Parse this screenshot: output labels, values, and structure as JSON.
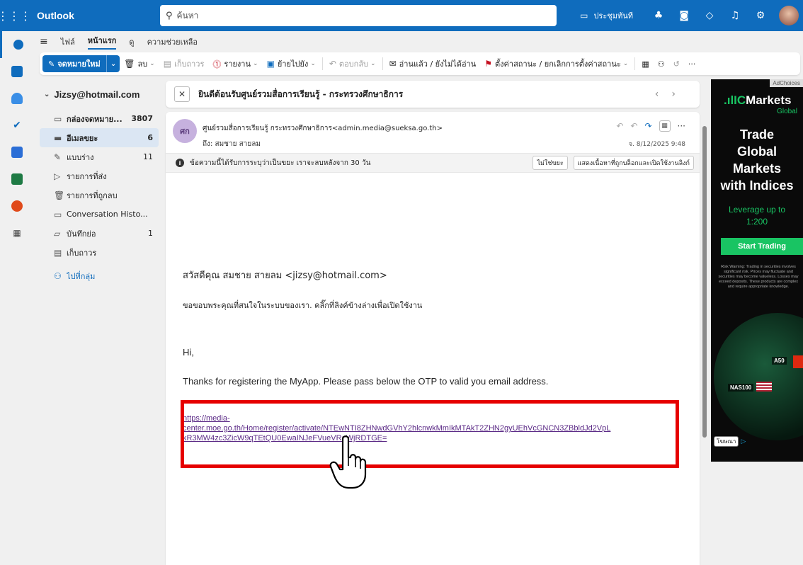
{
  "topbar": {
    "app_name": "Outlook",
    "search_placeholder": "ค้นหา",
    "meet_now": "ประชุมทันที",
    "icons": [
      "waffle-icon",
      "teams-icon",
      "outlook-icon",
      "feedback-icon",
      "bell-icon",
      "gear-icon"
    ]
  },
  "menu": {
    "items": [
      "ไฟล์",
      "หน้าแรก",
      "ดู",
      "ความช่วยเหลือ"
    ],
    "selected": "หน้าแรก"
  },
  "ribbon": {
    "new_mail": "จดหมายใหม่",
    "delete": "ลบ",
    "archive": "เก็บถาวร",
    "report": "รายงาน",
    "move_to": "ย้ายไปยัง",
    "reply": "ตอบกลับ",
    "read_unread": "อ่านแล้ว / ยังไม่ได้อ่าน",
    "flag": "ตั้งค่าสถานะ / ยกเลิกการตั้งค่าสถานะ",
    "more": "···"
  },
  "folders": {
    "account": "Jizsy@hotmail.com",
    "items": [
      {
        "label": "กล่องจดหมาย...",
        "count": "3807",
        "bold": true,
        "icon": "inbox-icon"
      },
      {
        "label": "อีเมลขยะ",
        "count": "6",
        "bold": true,
        "selected": true,
        "icon": "junk-icon"
      },
      {
        "label": "แบบร่าง",
        "count": "11",
        "icon": "draft-icon"
      },
      {
        "label": "รายการที่ส่ง",
        "count": "",
        "icon": "sent-icon"
      },
      {
        "label": "รายการที่ถูกลบ",
        "count": "",
        "icon": "trash-icon"
      },
      {
        "label": "Conversation Histo...",
        "count": "",
        "icon": "folder-icon"
      },
      {
        "label": "บันทึกย่อ",
        "count": "1",
        "icon": "note-icon"
      },
      {
        "label": "เก็บถาวร",
        "count": "",
        "icon": "archive-icon"
      },
      {
        "label": "ไปที่กลุ่ม",
        "count": "",
        "icon": "groups-icon",
        "link": true
      }
    ]
  },
  "message": {
    "subject": "ยินดีต้อนรับศูนย์รวมสื่อการเรียนรู้ - กระทรวงศึกษาธิการ",
    "avatar_initials": "ศก",
    "sender": "ศูนย์รวมสื่อการเรียนรู้ กระทรวงศึกษาธิการ<admin.media@sueksa.go.th>",
    "to": "ถึง: สมชาย สายลม",
    "date": "จ. 8/12/2025 9:48",
    "junk_notice": "ข้อความนี้ได้รับการระบุว่าเป็นขยะ เราจะลบหลังจาก 30 วัน",
    "not_junk": "ไม่ใช่ขยะ",
    "show_blocked": "แสดงเนื้อหาที่ถูกบล็อกและเปิดใช้งานลิงก์",
    "greeting": "สวัสดีคุณ สมชาย สายลม <jizsy@hotmail.com>",
    "thai_line": "ขอขอบพระคุณที่สนใจในระบบของเรา. คลิ๊กที่ลิงค์ข้างล่างเพื่อเปิดใช้งาน",
    "hi": "Hi,",
    "en_line": "Thanks for registering the MyApp. Please pass below the OTP to valid you email address.",
    "link_l1": "https://media-",
    "link_l2": "center.moe.go.th/Home/register/activate/NTEwNTI8ZHNwdGVhY2hlcnwkMmIkMTAkT2ZHN2gyUEhVcGNCN3ZBbldJd2VpL",
    "link_l3": "kR3MW4zc3ZicW9qTEtQU0EwaINJeFVueVRaWjRDTGE="
  },
  "ad": {
    "adchoices": "AdChoices",
    "brand_ic": "IC",
    "brand_rest": "Markets",
    "global": "Global",
    "headline": [
      "Trade",
      "Global",
      "Markets",
      "with Indices"
    ],
    "leverage": [
      "Leverage up to",
      "1:200"
    ],
    "cta": "Start Trading",
    "risk": "Risk Warning: Trading in securities involves significant risk. Prices may fluctuate and securities may become valueless. Losses may exceed deposits. These products are complex and require appropriate knowledge.",
    "tag_a50": "A50",
    "tag_nas": "NAS100",
    "ad_label": "โฆษณา",
    "colors": {
      "green": "#19c463"
    }
  }
}
